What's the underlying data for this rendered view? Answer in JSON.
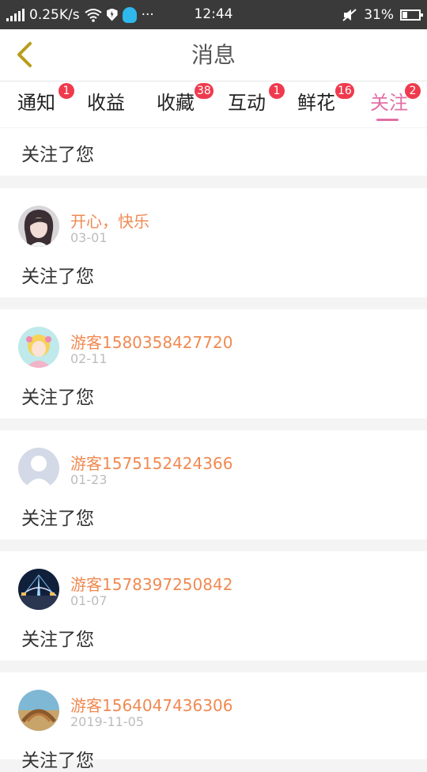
{
  "status_bar": {
    "speed": "0.25K/s",
    "time": "12:44",
    "battery": "31%",
    "more": "···"
  },
  "header": {
    "title": "消息"
  },
  "tabs": [
    {
      "label": "通知",
      "badge": "1"
    },
    {
      "label": "收益",
      "badge": ""
    },
    {
      "label": "收藏",
      "badge": "38"
    },
    {
      "label": "互动",
      "badge": "1"
    },
    {
      "label": "鲜花",
      "badge": "16"
    },
    {
      "label": "关注",
      "badge": "2",
      "active": true
    }
  ],
  "top_item": {
    "message": "关注了您"
  },
  "items": [
    {
      "username": "开心，快乐",
      "date": "03-01",
      "message": "关注了您"
    },
    {
      "username": "游客1580358427720",
      "date": "02-11",
      "message": "关注了您"
    },
    {
      "username": "游客1575152424366",
      "date": "01-23",
      "message": "关注了您"
    },
    {
      "username": "游客1578397250842",
      "date": "01-07",
      "message": "关注了您"
    },
    {
      "username": "游客1564047436306",
      "date": "2019-11-05",
      "message": "关注了您"
    }
  ],
  "colors": {
    "accent": "#e16fa5",
    "badge": "#ef3a4d",
    "username": "#f08a52",
    "back_arrow": "#b89c1a"
  }
}
